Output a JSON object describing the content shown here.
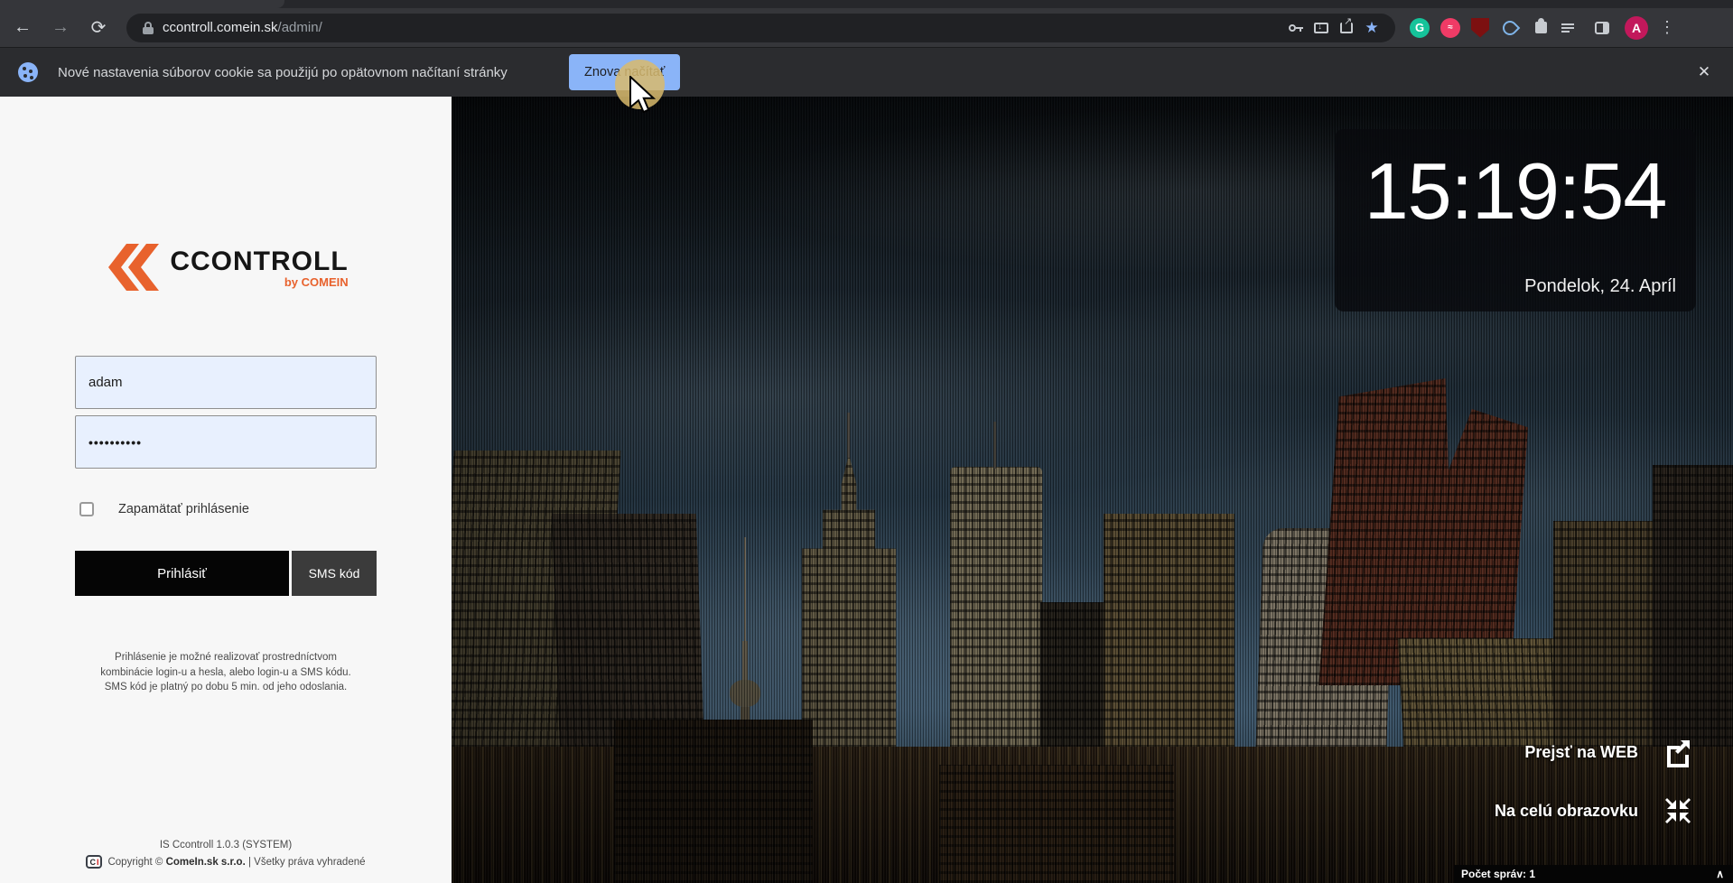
{
  "browser": {
    "url_domain": "ccontroll.comein.sk",
    "url_path": "/admin/",
    "icons": {
      "back": "←",
      "forward": "→",
      "reload": "⟳",
      "bookmark_star": "★",
      "grammarly": "G",
      "avatar": "A",
      "menu_dots": "⋮"
    }
  },
  "cookie_bar": {
    "message": "Nové nastavenia súborov cookie sa použijú po opätovnom načítaní stránky",
    "reload_button": "Znova načítať",
    "close": "✕"
  },
  "login": {
    "logo_text": "CCONTROLL",
    "logo_sub": "by COMEIN",
    "username_value": "adam",
    "password_value": "••••••••••",
    "remember_label": "Zapamätať prihlásenie",
    "login_button": "Prihlásiť",
    "sms_button": "SMS kód",
    "info_lines": {
      "0": "Prihlásenie je možné realizovať prostredníctvom",
      "1": "kombinácie login-u a hesla, alebo login-u a SMS kódu.",
      "2": "SMS kód je platný po dobu 5 min. od jeho odoslania."
    },
    "version": "IS Ccontroll 1.0.3 (SYSTEM)",
    "ci_icon_c": "C",
    "ci_icon_i": "I",
    "copyright_prefix": "Copyright © ",
    "copyright_company": "ComeIn.sk s.r.o.",
    "copyright_suffix": " | Všetky práva vyhradené"
  },
  "clock": {
    "time": "15:19:54",
    "date": "Pondelok, 24. Apríl"
  },
  "overlay": {
    "web_button": "Prejsť na WEB",
    "fullscreen_button": "Na celú obrazovku",
    "messages_label": "Počet správ: 1",
    "collapse_chevron": "∧"
  },
  "colors": {
    "accent_orange": "#e8622d",
    "chrome_blue": "#8ab4f8",
    "autofill_blue": "#e8f0fe"
  }
}
